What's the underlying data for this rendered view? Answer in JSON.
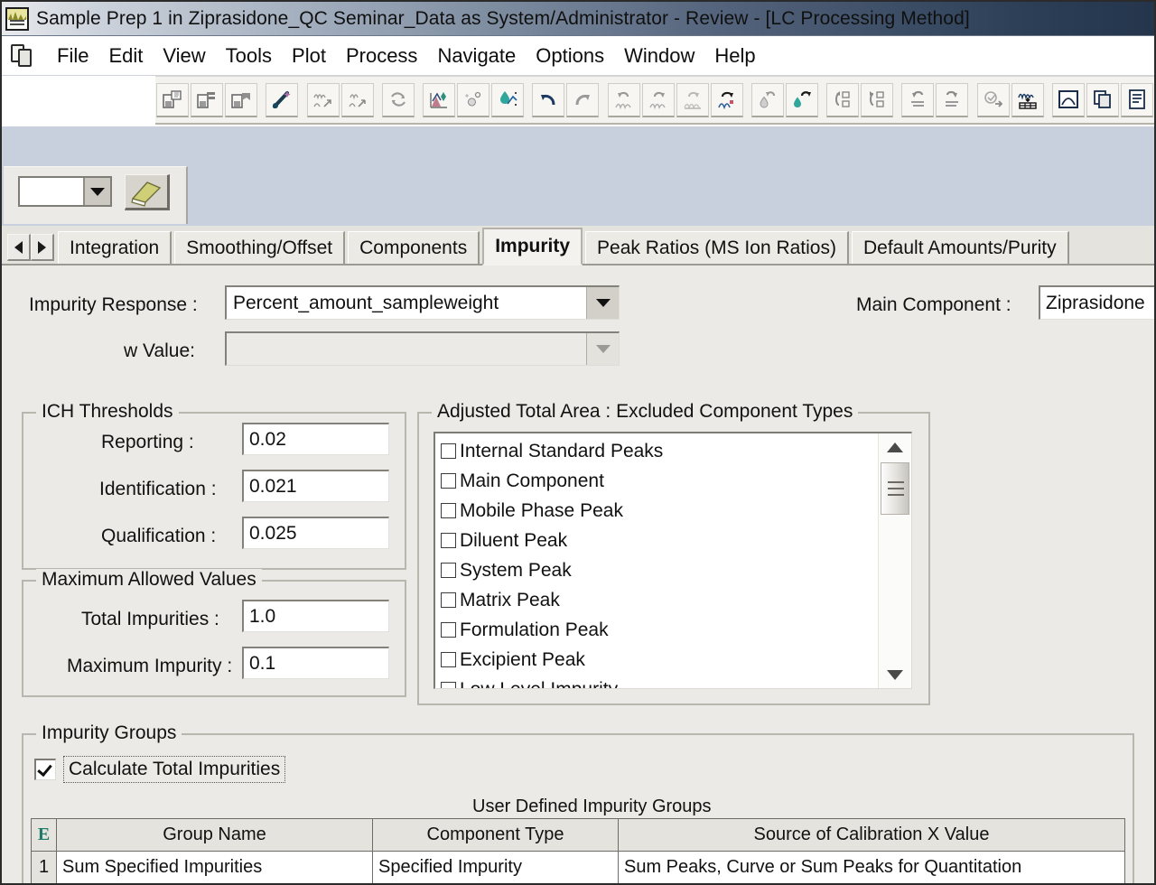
{
  "window": {
    "title": "Sample Prep 1 in Ziprasidone_QC Seminar_Data as System/Administrator - Review - [LC Processing Method]",
    "app_icon": "chromatogram-icon"
  },
  "menu": {
    "doc_icon": "documents-icon",
    "items": [
      "File",
      "Edit",
      "View",
      "Tools",
      "Plot",
      "Process",
      "Navigate",
      "Options",
      "Window",
      "Help"
    ]
  },
  "toolbar": {
    "buttons": [
      "save-method-icon",
      "save-as-icon",
      "save-all-icon",
      "wand-icon",
      "integrate-icon",
      "integrate-single-icon",
      "refresh-icon",
      "calibrate-icon",
      "quantitate-icon",
      "quantitate-drop-icon",
      "undo-icon",
      "redo-icon",
      "undo-integration-icon",
      "redo-integration-icon",
      "clear-integration-icon",
      "apply-integration-icon",
      "undo-calibration-icon",
      "redo-calibration-icon",
      "undo-component-icon",
      "redo-component-icon",
      "undo-results-icon",
      "redo-results-icon",
      "process-batch-icon",
      "review-table-icon",
      "peak-view-icon",
      "copy-icon",
      "report-icon"
    ]
  },
  "secondary_bar": {
    "combo_value": "",
    "erase_button_icon": "eraser-icon"
  },
  "tabs": {
    "prev_icon": "chevron-left-icon",
    "next_icon": "chevron-right-icon",
    "items": [
      {
        "label": "Integration",
        "active": false
      },
      {
        "label": "Smoothing/Offset",
        "active": false
      },
      {
        "label": "Components",
        "active": false
      },
      {
        "label": "Impurity",
        "active": true
      },
      {
        "label": "Peak Ratios (MS Ion Ratios)",
        "active": false
      },
      {
        "label": "Default Amounts/Purity",
        "active": false
      }
    ]
  },
  "form": {
    "impurity_response_label": "Impurity Response :",
    "impurity_response_value": "Percent_amount_sampleweight",
    "w_value_label": "w Value:",
    "w_value_value": "",
    "main_component_label": "Main Component :",
    "main_component_value": "Ziprasidone"
  },
  "ich_thresholds": {
    "title": "ICH Thresholds",
    "fields": [
      {
        "label": "Reporting :",
        "value": "0.02"
      },
      {
        "label": "Identification :",
        "value": "0.021"
      },
      {
        "label": "Qualification :",
        "value": "0.025"
      }
    ]
  },
  "max_allowed": {
    "title": "Maximum Allowed Values",
    "fields": [
      {
        "label": "Total Impurities :",
        "value": "1.0"
      },
      {
        "label": "Maximum Impurity :",
        "value": "0.1"
      }
    ]
  },
  "excluded_types": {
    "title": "Adjusted Total Area : Excluded Component Types",
    "items": [
      {
        "label": "Internal Standard Peaks",
        "checked": false
      },
      {
        "label": "Main Component",
        "checked": false
      },
      {
        "label": "Mobile Phase Peak",
        "checked": false
      },
      {
        "label": "Diluent Peak",
        "checked": false
      },
      {
        "label": "System Peak",
        "checked": false
      },
      {
        "label": "Matrix Peak",
        "checked": false
      },
      {
        "label": "Formulation Peak",
        "checked": false
      },
      {
        "label": "Excipient Peak",
        "checked": false
      },
      {
        "label": "Low Level Impurity",
        "checked": false
      }
    ],
    "scroll_up_icon": "scroll-up-arrow-icon",
    "scroll_down_icon": "scroll-down-arrow-icon"
  },
  "impurity_groups": {
    "title": "Impurity Groups",
    "calculate_total_label": "Calculate Total Impurities",
    "calculate_total_checked": true,
    "table_caption": "User Defined Impurity Groups",
    "columns": [
      "E",
      "Group Name",
      "Component Type",
      "Source of Calibration X Value"
    ],
    "rows": [
      {
        "num": "1",
        "group_name": "Sum Specified Impurities",
        "component_type": "Specified Impurity",
        "source": "Sum Peaks, Curve or Sum Peaks for Quantitation"
      }
    ]
  },
  "colors": {
    "title_bar_dark": "#24354c",
    "panel_bg": "#ebeae6",
    "strip_bg": "#c8cfdd",
    "accent_teal": "#1f7a6b"
  }
}
